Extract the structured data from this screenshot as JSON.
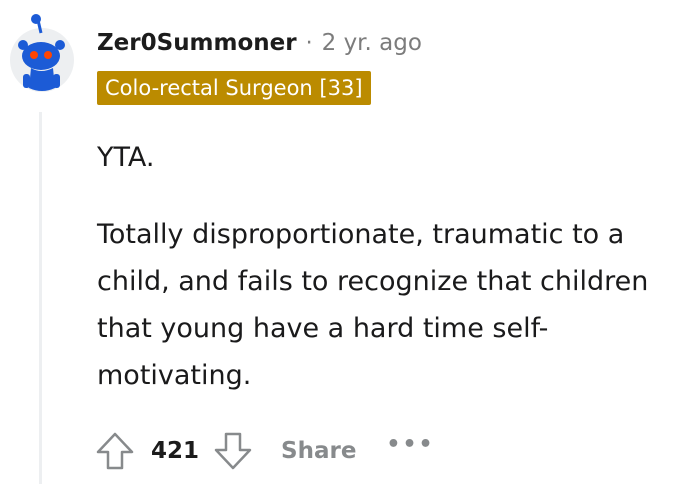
{
  "comment": {
    "author": "Zer0Summoner",
    "separator": "·",
    "time_ago": "2 yr. ago",
    "flair": "Colo-rectal Surgeon [33]",
    "paragraphs": [
      "YTA.",
      "Totally disproportionate, traumatic to a child, and fails to recognize that children that young have a hard time self-motivating."
    ],
    "score": "421",
    "share_label": "Share",
    "more_label": "•••"
  },
  "icons": {
    "avatar": "reddit-snoo-avatar-icon",
    "upvote": "upvote-arrow-icon",
    "downvote": "downvote-arrow-icon",
    "more": "more-options-icon"
  },
  "colors": {
    "flair_bg": "#bb8b00",
    "flair_text": "#ffffff",
    "meta_gray": "#7c7c7c",
    "action_gray": "#878a8c",
    "thread_line": "#edeff1",
    "snoo_blue": "#1c5bd6",
    "snoo_eye": "#ff4500"
  }
}
